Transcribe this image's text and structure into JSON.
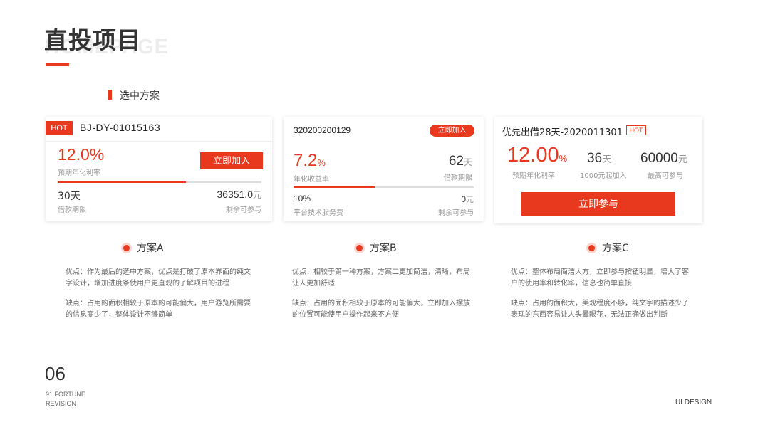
{
  "header": {
    "title": "直投项目",
    "background_word": "HOMEPAGE",
    "section_label": "选中方案"
  },
  "card_a": {
    "hot_badge": "HOT",
    "code": "BJ-DY-01015163",
    "rate": "12.0%",
    "rate_label": "预期年化利率",
    "join_button": "立即加入",
    "progress": 0.63,
    "days": "30天",
    "days_label": "借款期限",
    "remain_value": "36351.0",
    "remain_unit": "元",
    "remain_label": "剩余可参与"
  },
  "card_b": {
    "code": "320200200129",
    "join_button": "立即加入",
    "rate_value": "7.2",
    "rate_unit": "%",
    "rate_label": "年化收益率",
    "days_value": "62",
    "days_unit": "天",
    "days_label": "借款期限",
    "progress": 0.45,
    "fee": "10%",
    "fee_label": "平台技术服务费",
    "remain_value": "0",
    "remain_unit": "元",
    "remain_label": "剩余可参与"
  },
  "card_c": {
    "name": "优先出借28天-2020011301",
    "hot_badge": "HOT",
    "rate_value": "12.00",
    "rate_unit": "%",
    "rate_label": "预期年化利率",
    "days_value": "36",
    "days_unit": "天",
    "days_label": "1000元起加入",
    "max_value": "60000",
    "max_unit": "元",
    "max_label": "最高可参与",
    "join_button": "立即参与"
  },
  "plans": [
    {
      "title": "方案A",
      "pros": "优点：作为最后的选中方案，优点是打破了原本界面的纯文字设计，增加进度条使用户更直观的了解项目的进程",
      "cons": "缺点：占用的面积相较于原本的可能偏大，用户游览所需要的信息变少了，整体设计不够简单"
    },
    {
      "title": "方案B",
      "pros": "优点：相较于第一种方案，方案二更加简洁，清晰，布局让人更加舒适",
      "cons": "缺点：占用的面积相较于原本的可能偏大，立即加入摆放的位置可能使用户操作起来不方便"
    },
    {
      "title": "方案C",
      "pros": "优点：整体布局简洁大方，立即参与按钮明显，增大了客户的使用率和转化率，信息也简单直接",
      "cons": "缺点：占用的面积大，美观程度不够，纯文字的描述少了表现的东西容易让人头晕眼花，无法正确做出判断"
    }
  ],
  "footer": {
    "page_number": "06",
    "brand_line1": "91 FORTUNE",
    "brand_line2": "REVISION",
    "design_label": "UI DESIGN"
  },
  "colors": {
    "accent": "#e8391f",
    "text": "#333333",
    "muted": "#999999"
  }
}
